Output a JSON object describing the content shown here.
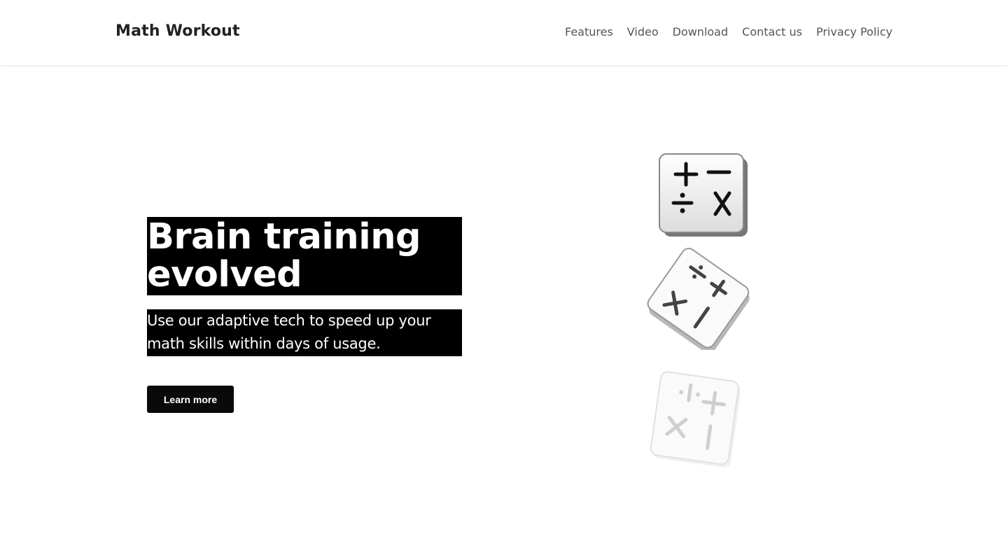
{
  "header": {
    "brand": "Math Workout",
    "nav": [
      "Features",
      "Video",
      "Download",
      "Contact us",
      "Privacy Policy"
    ]
  },
  "hero": {
    "title_line1": "Brain training",
    "title_line2": "evolved",
    "subtitle_line1": "Use our adaptive tech to speed up your",
    "subtitle_line2": "math skills within days of usage.",
    "cta": "Learn more"
  },
  "colors": {
    "text_dark": "#222222",
    "nav_text": "#555555",
    "highlight_bg": "#000000",
    "button_bg": "#0a0a0a"
  },
  "icons": [
    "math-operators-icon",
    "math-operators-icon",
    "math-operators-icon"
  ]
}
